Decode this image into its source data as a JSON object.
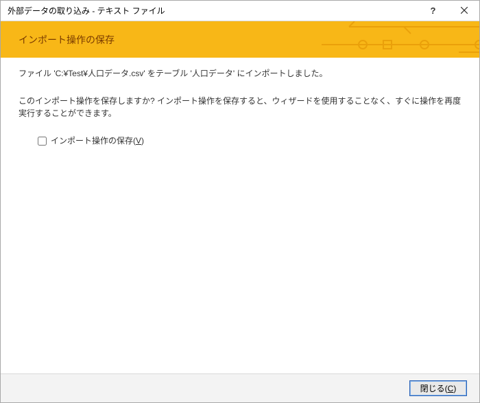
{
  "titlebar": {
    "title": "外部データの取り込み - テキスト ファイル",
    "help_label": "?",
    "close_label": "×"
  },
  "header": {
    "title": "インポート操作の保存"
  },
  "content": {
    "imported_message": "ファイル 'C:¥Test¥人口データ.csv' をテーブル '人口データ' にインポートしました。",
    "save_prompt": "このインポート操作を保存しますか? インポート操作を保存すると、ウィザードを使用することなく、すぐに操作を再度実行することができます。",
    "checkbox_label_main": "インポート操作の保存(",
    "checkbox_accel": "V",
    "checkbox_label_end": ")"
  },
  "footer": {
    "close_button_main": "閉じる(",
    "close_button_accel": "C",
    "close_button_end": ")"
  }
}
